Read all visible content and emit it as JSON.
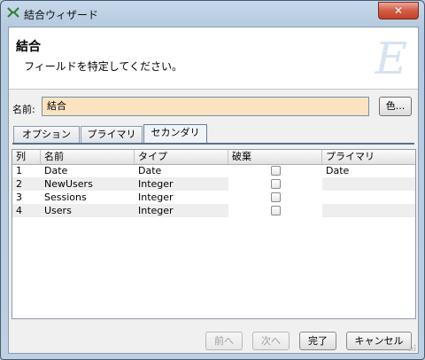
{
  "window": {
    "title": "結合ウィザード"
  },
  "header": {
    "title": "結合",
    "subtitle": "フィールドを特定してください。",
    "logo": "E"
  },
  "name_field": {
    "label": "名前:",
    "value": "結合"
  },
  "color_button": {
    "label": "色..."
  },
  "tabs": [
    {
      "label": "オプション",
      "active": false
    },
    {
      "label": "プライマリ",
      "active": false
    },
    {
      "label": "セカンダリ",
      "active": true
    }
  ],
  "table": {
    "columns": [
      "列",
      "名前",
      "タイプ",
      "破棄",
      "プライマリ"
    ],
    "rows": [
      {
        "col": "1",
        "name": "Date",
        "type": "Date",
        "discard": false,
        "primary": "Date"
      },
      {
        "col": "2",
        "name": "NewUsers",
        "type": "Integer",
        "discard": false,
        "primary": ""
      },
      {
        "col": "3",
        "name": "Sessions",
        "type": "Integer",
        "discard": false,
        "primary": ""
      },
      {
        "col": "4",
        "name": "Users",
        "type": "Integer",
        "discard": false,
        "primary": ""
      }
    ]
  },
  "buttons": {
    "back": "前へ",
    "next": "次へ",
    "finish": "完了",
    "cancel": "キャンセル"
  },
  "colors": {
    "name_input_bg": "#fbe3c2",
    "tab_line": "#5a6f89",
    "close_button": "#c2412b"
  }
}
